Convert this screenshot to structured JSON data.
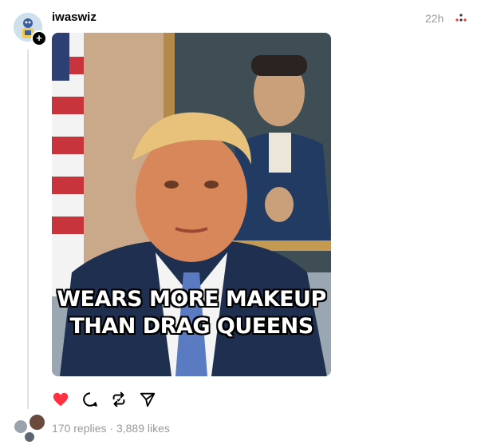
{
  "post": {
    "username": "iwaswiz",
    "timestamp": "22h",
    "image_caption_line1": "WEARS MORE MAKEUP",
    "image_caption_line2": "THAN DRAG QUEENS",
    "replies": "170 replies",
    "separator": "·",
    "likes": "3,889 likes",
    "liked": true
  },
  "icons": {
    "avatar": "avatar",
    "follow": "plus-icon",
    "more": "more-icon",
    "like": "heart-icon",
    "comment": "comment-icon",
    "repost": "repost-icon",
    "share": "send-icon"
  },
  "colors": {
    "like_red": "#ff3040",
    "muted_text": "#999999",
    "thread_line": "#e2e2e2"
  }
}
